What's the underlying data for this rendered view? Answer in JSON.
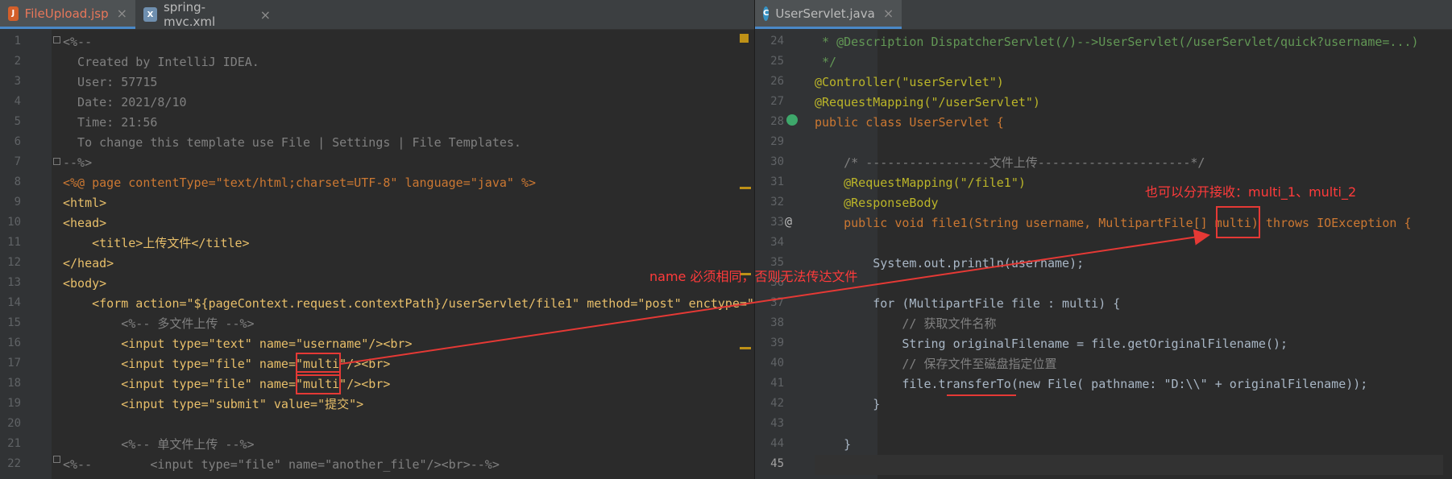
{
  "left": {
    "tabs": [
      {
        "label": "FileUpload.jsp",
        "icon": "jsp-file-icon",
        "active": true
      },
      {
        "label": "spring-mvc.xml",
        "icon": "xml-file-icon",
        "active": false
      }
    ],
    "line_numbers": [
      "1",
      "2",
      "3",
      "4",
      "5",
      "6",
      "7",
      "8",
      "9",
      "10",
      "11",
      "12",
      "13",
      "14",
      "15",
      "16",
      "17",
      "18",
      "19",
      "20",
      "21",
      "22"
    ],
    "code": [
      "<%--",
      "  Created by IntelliJ IDEA.",
      "  User: 57715",
      "  Date: 2021/8/10",
      "  Time: 21:56",
      "  To change this template use File | Settings | File Templates.",
      "--%>",
      "<%@ page contentType=\"text/html;charset=UTF-8\" language=\"java\" %>",
      "<html>",
      "<head>",
      "    <title>上传文件</title>",
      "</head>",
      "<body>",
      "    <form action=\"${pageContext.request.contextPath}/userServlet/file1\" method=\"post\" enctype=\"",
      "        <%-- 多文件上传 --%>",
      "        <input type=\"text\" name=\"username\"/><br>",
      "        <input type=\"file\" name=\"multi\"/><br>",
      "        <input type=\"file\" name=\"multi\"/><br>",
      "        <input type=\"submit\" value=\"提交\">",
      "",
      "        <%-- 单文件上传 --%>",
      "<%--        <input type=\"file\" name=\"another_file\"/><br>--%>"
    ]
  },
  "right": {
    "tabs": [
      {
        "label": "UserServlet.java",
        "icon": "java-class-icon",
        "active": true
      }
    ],
    "line_numbers": [
      "24",
      "25",
      "26",
      "27",
      "28",
      "29",
      "30",
      "31",
      "32",
      "33",
      "34",
      "35",
      "36",
      "37",
      "38",
      "39",
      "40",
      "41",
      "42",
      "43",
      "44",
      "45"
    ],
    "code": [
      " * @Description DispatcherServlet(/)-->UserServlet(/userServlet/quick?username=...)",
      " */",
      "@Controller(\"userServlet\")",
      "@RequestMapping(\"/userServlet\")",
      "public class UserServlet {",
      "",
      "    /* -----------------文件上传---------------------*/",
      "    @RequestMapping(\"/file1\")",
      "    @ResponseBody",
      "    public void file1(String username, MultipartFile[] multi) throws IOException {",
      "",
      "        System.out.println(username);",
      "",
      "        for (MultipartFile file : multi) {",
      "            // 获取文件名称",
      "            String originalFilename = file.getOriginalFilename();",
      "            // 保存文件至磁盘指定位置",
      "            file.transferTo(new File( pathname: \"D:\\\\\" + originalFilename));",
      "        }",
      "",
      "    }",
      ""
    ]
  },
  "annotations": {
    "left_note": "name 必须相同，否则无法传达文件",
    "right_note": "也可以分开接收：multi_1、multi_2"
  },
  "colors": {
    "background": "#2b2b2b",
    "gutter": "#313335",
    "annotation": "#ff3b3b",
    "tab_active_underline": "#4a88c7"
  }
}
